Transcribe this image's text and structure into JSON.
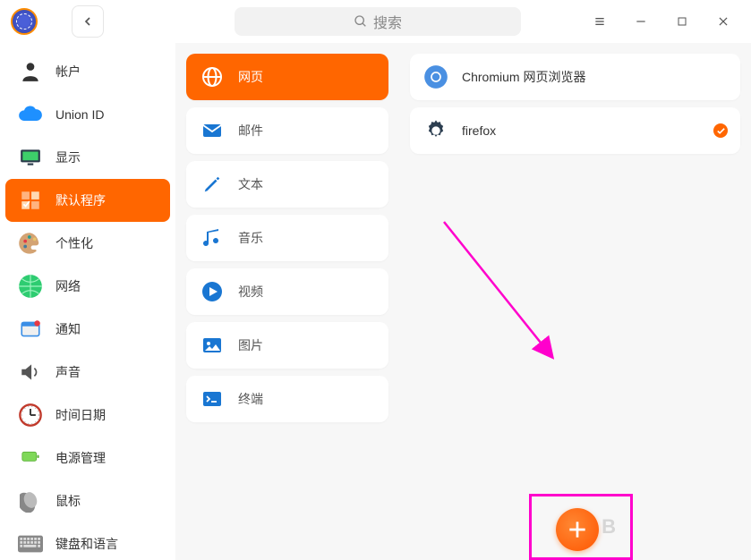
{
  "header": {
    "search_placeholder": "搜索"
  },
  "sidebar": {
    "items": [
      {
        "id": "account",
        "label": "帐户"
      },
      {
        "id": "union-id",
        "label": "Union ID"
      },
      {
        "id": "display",
        "label": "显示"
      },
      {
        "id": "default-apps",
        "label": "默认程序"
      },
      {
        "id": "personalize",
        "label": "个性化"
      },
      {
        "id": "network",
        "label": "网络"
      },
      {
        "id": "notification",
        "label": "通知"
      },
      {
        "id": "sound",
        "label": "声音"
      },
      {
        "id": "datetime",
        "label": "时间日期"
      },
      {
        "id": "power",
        "label": "电源管理"
      },
      {
        "id": "mouse",
        "label": "鼠标"
      },
      {
        "id": "keyboard",
        "label": "键盘和语言"
      }
    ],
    "active_id": "default-apps"
  },
  "categories": {
    "items": [
      {
        "id": "web",
        "label": "网页"
      },
      {
        "id": "mail",
        "label": "邮件"
      },
      {
        "id": "text",
        "label": "文本"
      },
      {
        "id": "music",
        "label": "音乐"
      },
      {
        "id": "video",
        "label": "视频"
      },
      {
        "id": "image",
        "label": "图片"
      },
      {
        "id": "terminal",
        "label": "终端"
      }
    ],
    "active_id": "web"
  },
  "apps": {
    "items": [
      {
        "id": "chromium",
        "label": "Chromium 网页浏览器",
        "default": false
      },
      {
        "id": "firefox",
        "label": "firefox",
        "default": true
      }
    ]
  },
  "colors": {
    "accent": "#ff6600"
  }
}
